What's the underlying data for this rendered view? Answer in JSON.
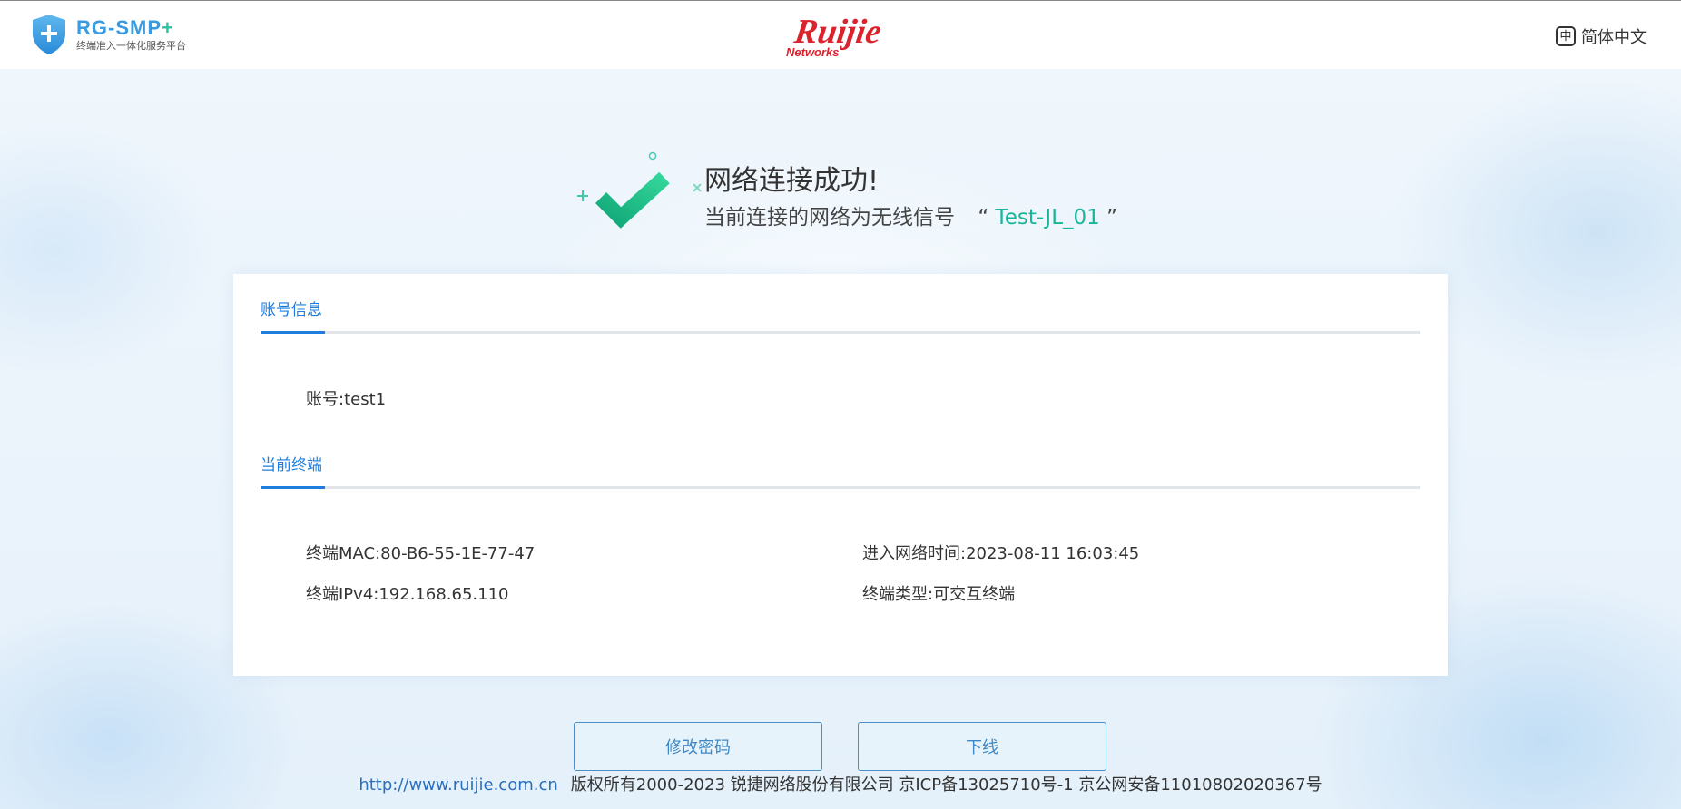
{
  "header": {
    "brand_name": "RG-SMP",
    "brand_plus": "+",
    "brand_subtitle": "终端准入一体化服务平台",
    "logo_alt": "Ruijie Networks",
    "logo_text": "Ruijie",
    "logo_subtext": "Networks",
    "lang_icon": "中",
    "lang_label": "简体中文"
  },
  "success": {
    "title": "网络连接成功!",
    "subtitle_prefix": "当前连接的网络为无线信号",
    "quote_open": "“",
    "ssid": "Test-JL_01",
    "quote_close": "”"
  },
  "account_section": {
    "tab_label": "账号信息",
    "account": "账号:test1"
  },
  "terminal_section": {
    "tab_label": "当前终端",
    "mac": "终端MAC:80-B6-55-1E-77-47",
    "ipv4": "终端IPv4:192.168.65.110",
    "join_time": "进入网络时间:2023-08-11 16:03:45",
    "type": "终端类型:可交互终端"
  },
  "buttons": {
    "change_password": "修改密码",
    "logout": "下线"
  },
  "footer": {
    "link": "http://www.ruijie.com.cn",
    "copyright": "版权所有2000-2023 锐捷网络股份有限公司 京ICP备13025710号-1 京公网安备11010802020367号"
  },
  "colors": {
    "accent_blue": "#1d7ee0",
    "ssid_green": "#18b59a",
    "brand_red": "#d9232d"
  }
}
